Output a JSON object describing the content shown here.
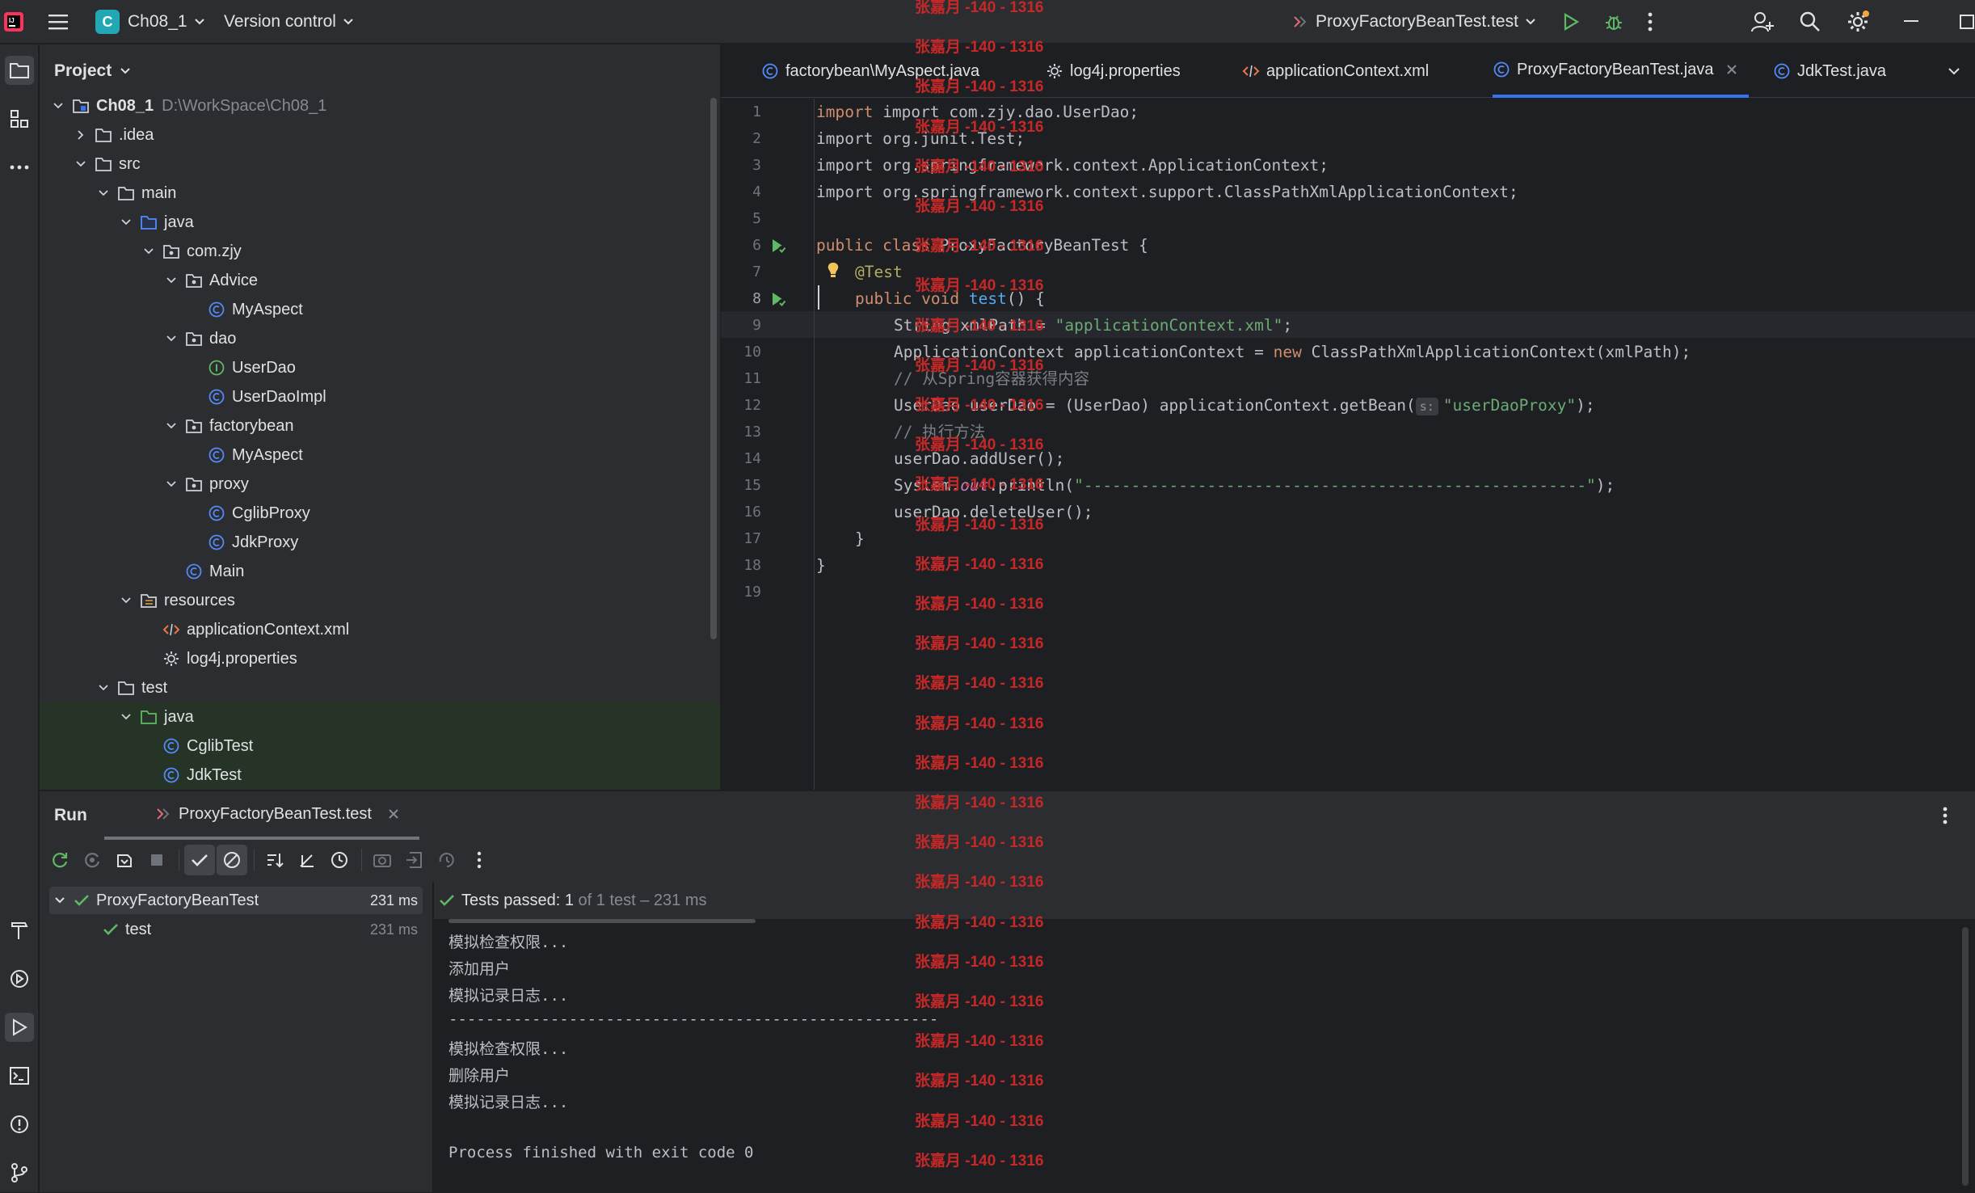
{
  "titlebar": {
    "project_letter": "C",
    "project_name": "Ch08_1",
    "vcs": "Version control",
    "run_config": "ProxyFactoryBeanTest.test"
  },
  "project_panel": {
    "title": "Project",
    "tree": [
      {
        "label": "Ch08_1",
        "path": "D:\\WorkSpace\\Ch08_1",
        "icon": "module-folder-icon",
        "expanded": true
      },
      {
        "label": ".idea",
        "icon": "folder-icon",
        "expanded": false
      },
      {
        "label": "src",
        "icon": "folder-icon",
        "expanded": true
      },
      {
        "label": "main",
        "icon": "folder-icon",
        "expanded": true
      },
      {
        "label": "java",
        "icon": "source-folder-icon",
        "expanded": true
      },
      {
        "label": "com.zjy",
        "icon": "package-icon",
        "expanded": true
      },
      {
        "label": "Advice",
        "icon": "package-icon",
        "expanded": true
      },
      {
        "label": "MyAspect",
        "icon": "class-icon"
      },
      {
        "label": "dao",
        "icon": "package-icon",
        "expanded": true
      },
      {
        "label": "UserDao",
        "icon": "interface-icon"
      },
      {
        "label": "UserDaoImpl",
        "icon": "class-icon"
      },
      {
        "label": "factorybean",
        "icon": "package-icon",
        "expanded": true
      },
      {
        "label": "MyAspect",
        "icon": "class-icon"
      },
      {
        "label": "proxy",
        "icon": "package-icon",
        "expanded": true
      },
      {
        "label": "CglibProxy",
        "icon": "class-icon"
      },
      {
        "label": "JdkProxy",
        "icon": "class-icon"
      },
      {
        "label": "Main",
        "icon": "class-icon"
      },
      {
        "label": "resources",
        "icon": "resources-folder-icon",
        "expanded": true
      },
      {
        "label": "applicationContext.xml",
        "icon": "xml-icon"
      },
      {
        "label": "log4j.properties",
        "icon": "properties-icon"
      },
      {
        "label": "test",
        "icon": "folder-icon",
        "expanded": true
      },
      {
        "label": "java",
        "icon": "test-folder-icon",
        "expanded": true
      },
      {
        "label": "CglibTest",
        "icon": "class-icon"
      },
      {
        "label": "JdkTest",
        "icon": "class-icon"
      }
    ]
  },
  "editor": {
    "tabs": [
      {
        "label": "factorybean\\MyAspect.java",
        "icon": "class-icon"
      },
      {
        "label": "log4j.properties",
        "icon": "properties-icon"
      },
      {
        "label": "applicationContext.xml",
        "icon": "xml-icon"
      },
      {
        "label": "ProxyFactoryBeanTest.java",
        "icon": "class-icon",
        "active": true
      },
      {
        "label": "JdkTest.java",
        "icon": "class-icon"
      }
    ],
    "line_numbers": [
      "1",
      "2",
      "3",
      "4",
      "5",
      "6",
      "7",
      "8",
      "9",
      "10",
      "11",
      "12",
      "13",
      "14",
      "15",
      "16",
      "17",
      "18",
      "19"
    ],
    "code": {
      "l1": "import com.zjy.dao.UserDao;",
      "l2": "import org.junit.Test;",
      "l3": "import org.springframework.context.ApplicationContext;",
      "l4": "import org.springframework.context.support.ClassPathXmlApplicationContext;",
      "l6a": "public class ",
      "l6b": "ProxyFactoryBeanTest {",
      "l7": "@Test",
      "l8a": "public void ",
      "l8b": "test",
      "l8c": "() {",
      "l9a": "String xmlPath = ",
      "l9b": "\"applicationContext.xml\"",
      "l9c": ";",
      "l10a": "ApplicationContext applicationContext = ",
      "l10b": "new ",
      "l10c": "ClassPathXmlApplicationContext(xmlPath);",
      "l11": "// 从Spring容器获得内容",
      "l12a": "UserDao userDao = (UserDao) applicationContext.getBean(",
      "l12hint": "s:",
      "l12b": "\"userDaoProxy\"",
      "l12c": ");",
      "l13": "// 执行方法",
      "l14": "userDao.addUser();",
      "l15a": "System.",
      "l15b": "out",
      "l15c": ".println(",
      "l15d": "\"-----------------------------------------------------\"",
      "l15e": ");",
      "l16": "userDao.deleteUser();",
      "l17": "}",
      "l18": "}"
    }
  },
  "run_panel": {
    "title": "Run",
    "tab": "ProxyFactoryBeanTest.test",
    "tests": [
      {
        "name": "ProxyFactoryBeanTest",
        "time": "231 ms"
      },
      {
        "name": "test",
        "time": "231 ms"
      }
    ],
    "status_prefix": "Tests passed: ",
    "status_count": "1",
    "status_suffix": " of 1 test – 231 ms",
    "console": [
      "模拟检查权限...",
      "添加用户",
      "模拟记录日志...",
      "-----------------------------------------------------",
      "模拟检查权限...",
      "删除用户",
      "模拟记录日志...",
      "",
      "Process finished with exit code 0"
    ]
  },
  "watermark": "张嘉月 -140 - 1316",
  "colors": {
    "accent": "#3574f0",
    "pass_green": "#5fb865",
    "watermark_red": "#c62828",
    "keyword": "#cf8e6d",
    "string": "#6aab73"
  }
}
